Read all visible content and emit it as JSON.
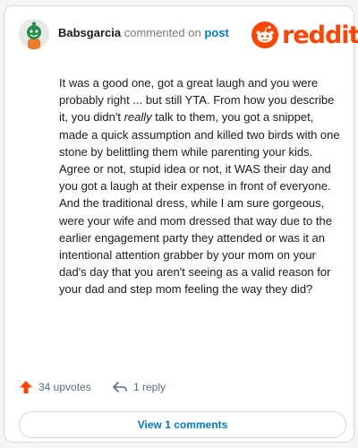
{
  "comment": {
    "author": "Babsgarcia",
    "action_text": "commented on",
    "target_link": "post",
    "body_before": "It was a good one, got a great laugh and you were probably right ... but still YTA. From how you describe it, you didn't ",
    "body_emphasis": "really",
    "body_after": " talk to them, you got a snippet, made a quick assumption and killed two birds with one stone by belittling them while parenting your kids. Agree or not, stupid idea or not, it WAS their day and you got a laugh at their expense in front of everyone. And the traditional dress, while I am sure gorgeous, were your wife and mom dressed that way due to the earlier engagement party they attended or was it an intentional attention grabber by your mom on your dad's day that you aren't seeing as a valid reason for your dad and step mom feeling the way they did?"
  },
  "brand": {
    "name": "reddit",
    "color": "#ff4500"
  },
  "actions": {
    "upvotes": "34 upvotes",
    "replies": "1 reply"
  },
  "footer": {
    "view_comments": "View 1 comments"
  },
  "icons": {
    "avatar": "snoo-avatar-icon",
    "logo": "reddit-logo-icon",
    "upvote": "upvote-arrow-icon",
    "reply": "reply-arrow-icon"
  }
}
